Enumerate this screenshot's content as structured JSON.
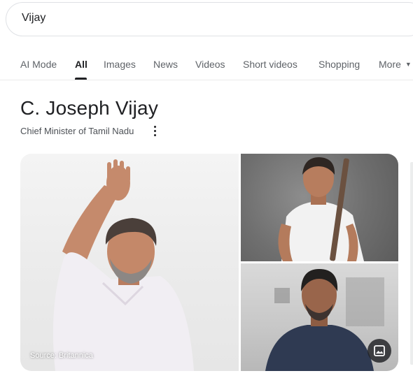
{
  "search": {
    "query": "Vijay"
  },
  "tabs": [
    {
      "label": "AI Mode"
    },
    {
      "label": "All"
    },
    {
      "label": "Images"
    },
    {
      "label": "News"
    },
    {
      "label": "Videos"
    },
    {
      "label": "Short videos"
    },
    {
      "label": "Shopping"
    },
    {
      "label": "More"
    }
  ],
  "active_tab": "All",
  "knowledge_panel": {
    "title": "C. Joseph Vijay",
    "subtitle": "Chief Minister of Tamil Nadu",
    "images": {
      "main_source": "Source: Britannica"
    }
  },
  "icons": {
    "more_options": "more-vert-icon",
    "more_dropdown": "chevron-down-icon",
    "image_search": "image-icon"
  },
  "colors": {
    "text_primary": "#202124",
    "text_secondary": "#5f6368",
    "border": "#dfe1e5"
  }
}
